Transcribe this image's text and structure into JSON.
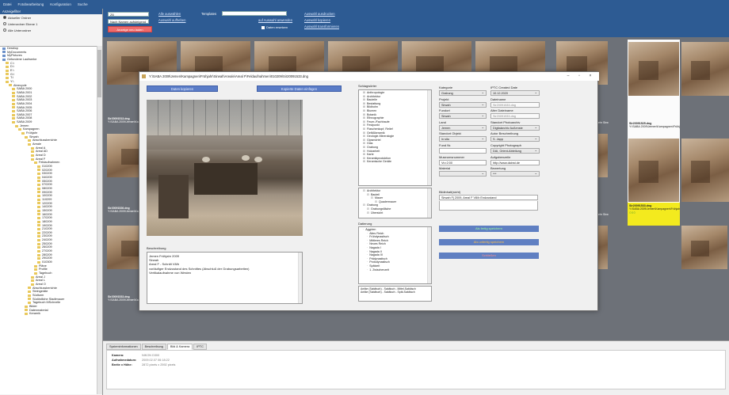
{
  "menu": [
    "Datei",
    "Fotobearbeitung",
    "Konfiguration",
    "Suche"
  ],
  "left": {
    "section": "Anzeigefilter",
    "radios": [
      {
        "label": "Aktueller Ordner",
        "on": true
      },
      {
        "label": "Unterordner Ebene 1",
        "on": false
      },
      {
        "label": "Alle Unterordner",
        "on": false
      }
    ],
    "tree": [
      {
        "t": "Desktop",
        "d": 0
      },
      {
        "t": "MyDocuments",
        "d": 0
      },
      {
        "t": "MyPictures",
        "d": 0
      },
      {
        "t": "Gefundene Laufwerke",
        "d": 0
      },
      {
        "t": "C:\\",
        "d": 1
      },
      {
        "t": "D:\\",
        "d": 1
      },
      {
        "t": "E:\\",
        "d": 1
      },
      {
        "t": "G:\\",
        "d": 1
      },
      {
        "t": "T:\\",
        "d": 1
      },
      {
        "t": "Y:\\",
        "d": 1
      },
      {
        "t": "Abrecycle",
        "d": 2
      },
      {
        "t": "SABA 2000",
        "d": 3
      },
      {
        "t": "SABA 2001",
        "d": 3
      },
      {
        "t": "SABA 2002",
        "d": 3
      },
      {
        "t": "SABA 2003",
        "d": 3
      },
      {
        "t": "SABA 2004",
        "d": 3
      },
      {
        "t": "SABA 2005",
        "d": 3
      },
      {
        "t": "SABA 2006",
        "d": 3
      },
      {
        "t": "SABA 2007",
        "d": 3
      },
      {
        "t": "SABA 2008",
        "d": 3
      },
      {
        "t": "SABA 2009",
        "d": 3
      },
      {
        "t": "Jemen",
        "d": 4
      },
      {
        "t": "Kampagnen",
        "d": 5
      },
      {
        "t": "Frühjahr",
        "d": 6
      },
      {
        "t": "Sirwah",
        "d": 7
      },
      {
        "t": "Abschlussberichte",
        "d": 8
      },
      {
        "t": "Areale",
        "d": 8
      },
      {
        "t": "Areal A",
        "d": 9
      },
      {
        "t": "Areal AD",
        "d": 9
      },
      {
        "t": "Areal D",
        "d": 9
      },
      {
        "t": "Areal F",
        "d": 9
      },
      {
        "t": "Feldaufnahmen",
        "d": 10
      },
      {
        "t": "010209",
        "d": 11
      },
      {
        "t": "020209",
        "d": 11
      },
      {
        "t": "030209",
        "d": 11
      },
      {
        "t": "040209",
        "d": 11
      },
      {
        "t": "050209",
        "d": 11
      },
      {
        "t": "070209",
        "d": 11
      },
      {
        "t": "080209",
        "d": 11
      },
      {
        "t": "090209",
        "d": 11
      },
      {
        "t": "100209",
        "d": 11
      },
      {
        "t": "110209",
        "d": 11
      },
      {
        "t": "120209",
        "d": 11
      },
      {
        "t": "140209",
        "d": 11
      },
      {
        "t": "150209",
        "d": 11
      },
      {
        "t": "160209",
        "d": 11
      },
      {
        "t": "170209",
        "d": 11
      },
      {
        "t": "180209",
        "d": 11
      },
      {
        "t": "190209",
        "d": 11
      },
      {
        "t": "210209",
        "d": 11
      },
      {
        "t": "220209",
        "d": 11
      },
      {
        "t": "230209",
        "d": 11
      },
      {
        "t": "240209",
        "d": 11
      },
      {
        "t": "250209",
        "d": 11
      },
      {
        "t": "260209",
        "d": 11
      },
      {
        "t": "270209",
        "d": 11
      },
      {
        "t": "280209",
        "d": 11
      },
      {
        "t": "290209",
        "d": 11
      },
      {
        "t": "010309",
        "d": 11
      },
      {
        "t": "Pläne",
        "d": 10
      },
      {
        "t": "Profile",
        "d": 10
      },
      {
        "t": "Tagebuch",
        "d": 10
      },
      {
        "t": "Areal J",
        "d": 9
      },
      {
        "t": "Areal L",
        "d": 9
      },
      {
        "t": "Areal O",
        "d": 9
      },
      {
        "t": "Abschlussberichte",
        "d": 8
      },
      {
        "t": "Steingeräte",
        "d": 8
      },
      {
        "t": "Südturm",
        "d": 8
      },
      {
        "t": "Südöstliche Stadtmauer",
        "d": 8
      },
      {
        "t": "Tagebuch MSchnelle",
        "d": 8
      },
      {
        "t": "Bilder",
        "d": 7
      },
      {
        "t": "Datenmaterial",
        "d": 7
      },
      {
        "t": "Keramik",
        "d": 7
      }
    ]
  },
  "top": {
    "select1": "Z6",
    "select2": "Nach Namen aufsteigend",
    "link_all": "Alle auswählen",
    "link_clear": "Auswahl aufheben",
    "templates_label": "Templates",
    "link_apply": "auf Auswahl anwenden",
    "checkbox": "Daten ersetzen",
    "link_print": "Auswahl ausdrucken",
    "link_export": "Auswahl kopieren",
    "link_transform": "Auswahl transformieren",
    "show_btn": "Anzeige neu laden"
  },
  "gallery": {
    "captions": [
      {
        "name": "Sir20091513.dng",
        "path": "Y:\\SABA 2009\\Jemen\\Kampagnen\\Frühjahr\\Sirw"
      },
      {
        "name": "Sir20091526.dng",
        "path": "Y:\\SABA 2009\\Jemen\\Kampagnen\\Frühjahr\\Sirw"
      },
      {
        "name": "Sir20091533.dng",
        "path": "Y:\\SABA 2009\\Jemen\\Kampagnen\\Frühjahr\\Sirw"
      }
    ],
    "right_caption1": {
      "name": "Sir20091525.dng",
      "path": "Y:\\SABA 2009\\Jemen\\Kampagnen\\Frühjahr\\Sirw"
    },
    "highlight_caption": {
      "name": "Sir20091533.dng",
      "path": "Y:\\SABA 2009\\Jemen\\Kampagnen\\Frühjahr\\Sirw"
    },
    "right_caption2": {
      "name": "Sir20091526.dng",
      "path": "Y:\\SABA 2009\\Jemen\\Kampagnen\\Frühjahr\\Sirw"
    },
    "right_caption3": {
      "name": "Sir20091530.dng",
      "path": "Y:\\SABA 2009\\Jemen\\Kampagnen\\Frühjahr\\Sirw"
    },
    "mid_caption": {
      "path": "ehr Sirw"
    },
    "stars": "○○○"
  },
  "info": {
    "tabs": [
      "Systeminformationen",
      "Beschreibung",
      "Bild & Kamera",
      "IPTC"
    ],
    "active_tab": 2,
    "rows": [
      {
        "k": "Kamera:",
        "v": "NIKON D300"
      },
      {
        "k": "Aufnahmedatum:",
        "v": "2009.02.07 06:18:22"
      },
      {
        "k": "Breite x Höhe:",
        "v": "2872 pixels x 2592 pixels"
      }
    ]
  },
  "dialog": {
    "title": "Y:\\SABA 2009\\Jemen\\Kampagnen\\Frühjahr\\Sirwah\\Areale\\Areal F\\Feldaufnahmen\\010209\\Sir20091533.dng",
    "btn_copy": "Daten kopieren",
    "btn_paste": "Kopierte Daten einfügen",
    "desc_label": "Beschreibung",
    "desc_lines": [
      "Jemen Frühjahr 2009",
      "Sirwah",
      "Areal F - Schnitt V8/b",
      "vorläufiger Endzustand des Schnittes (Abschluß der Grabungsarbeiten)",
      "Vertikalaufnahme von Westen"
    ],
    "keywords_label": "Schlagwörter",
    "keywords": [
      "Anthropologie",
      "Architektur",
      "Bauteile",
      "Bestattung",
      "Bildhohn",
      "Blumen",
      "Botanik",
      "Ethnographie",
      "Feuer-/Fachhaufe",
      "Festpunkt",
      "Flaschenkopf, Relief",
      "Gefäßkeramik",
      "Geologie-Mineralogie",
      "Gipsmörtel",
      "Glas",
      "Grabung",
      "Holzarbeit",
      "Karte",
      "Keramikproduktion",
      "Keramische Geräte"
    ],
    "selected_label": "Architektur",
    "selected_tree": [
      {
        "t": "Architektur",
        "d": 0
      },
      {
        "t": "Bauteil",
        "d": 1
      },
      {
        "t": "Mauer",
        "d": 2
      },
      {
        "t": "Quadermauer",
        "d": 3
      },
      {
        "t": "Grabung",
        "d": 0
      },
      {
        "t": "Grabungsfläche",
        "d": 1
      },
      {
        "t": "Übersicht",
        "d": 1
      }
    ],
    "dating_label": "Datierung",
    "dating": [
      "Ägypten",
      "Altes Reich",
      "Frühdynastisch",
      "Mittleres Reich",
      "Neues Reich",
      "Nagada I",
      "Nagada II",
      "Nagada III",
      "Prädynastisch",
      "Protodynastisch",
      "Spätzeit",
      "1. Zwischenzeit"
    ],
    "dating_value": "Antike (Sabäisch) - Sabäisch - Mittel-Sabäisch\nAntike (Sabäisch) - Sabäisch - Spät-Sabäisch",
    "fields": {
      "kategorie_l": "Kategorie",
      "kategorie": "Grabung",
      "projekt_l": "Projekt",
      "projekt": "Sirwah",
      "fundort_l": "Fundort",
      "fundort": "Sirwah",
      "land_l": "Land",
      "land": "Jemen",
      "standort_l": "Standort Objekt",
      "standort": "in situ",
      "fundnr_l": "Fund Nr.",
      "fundnr": "",
      "museum_l": "Museumsnummer",
      "museum": "Vrv:2:00",
      "material_l": "Material",
      "material": "",
      "bildinhalt_l": "Bildinhalt(sicht)",
      "bildinhalt": "Sirwah Fj 2009, Areal F V8/b Endzustand",
      "iptc_date_l": "IPTC Created Date",
      "iptc_date": "10.12.2020",
      "dateiname_l": "Dateiname",
      "dateiname": "Sir20091533.dng",
      "alt_dateiname_l": "Alter Dateiname",
      "alt_dateiname": "Sir20091533.dng",
      "photoarchiv_l": "Standort Photoarchiv",
      "photoarchiv": "Digitalarchiv Außenste",
      "autor_l": "Autor Beschreibung",
      "autor": "S. Japp",
      "copyright_l": "Copyright Photograph",
      "copyright": "DAI, Orient-Abteilung",
      "aufgabenzeile_l": "Aufgabenzeile",
      "aufgabenzeile": "http://www.dainst.de",
      "bewertung_l": "Bewertung",
      "bewertung": "***"
    },
    "btn_fertig": "Als fertig speichern",
    "btn_unfertig": "Als unfertig speichern",
    "btn_close": "Schließen"
  }
}
